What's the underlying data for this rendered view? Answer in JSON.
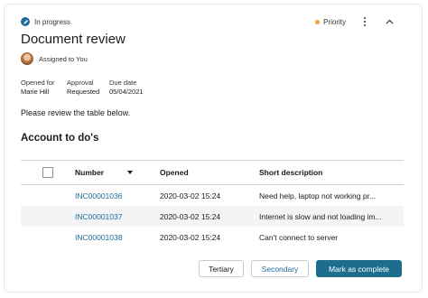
{
  "header": {
    "status_label": "In progress",
    "status_icon": "pencil-icon",
    "priority_label": "Priority",
    "priority_color": "#f1a33c",
    "title": "Document review",
    "assigned_label": "Assigned to You"
  },
  "meta": {
    "opened_for_label": "Opened for",
    "opened_for_value": "Marie Hill",
    "approval_label": "Approval",
    "approval_value": "Requested",
    "due_label": "Due date",
    "due_value": "05/04/2021"
  },
  "instructions": "Please review the table below.",
  "section_title": "Account to do's",
  "table": {
    "columns": {
      "number": "Number",
      "opened": "Opened",
      "description": "Short description"
    },
    "rows": [
      {
        "number": "INC00001036",
        "opened": "2020-03-02 15:24",
        "description": "Need help, laptop not working pr..."
      },
      {
        "number": "INC00001037",
        "opened": "2020-03-02 15:24",
        "description": "Internet is slow and not loading im..."
      },
      {
        "number": "INC00001038",
        "opened": "2020-03-02 15:24",
        "description": "Can't connect to server"
      }
    ]
  },
  "footer": {
    "tertiary_label": "Tertiary",
    "secondary_label": "Secondary",
    "primary_label": "Mark as complete"
  },
  "colors": {
    "accent": "#1f6c9c",
    "primary_button": "#1d6d8f"
  }
}
